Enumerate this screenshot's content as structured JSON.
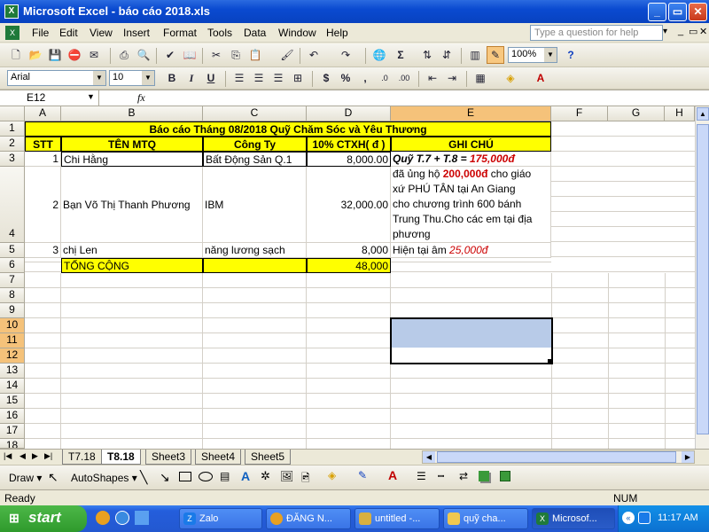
{
  "window": {
    "title": "Microsoft Excel - báo cáo 2018.xls",
    "minimize": "_",
    "restore": "▭",
    "close": "✕"
  },
  "menu": {
    "items": [
      "File",
      "Edit",
      "View",
      "Insert",
      "Format",
      "Tools",
      "Data",
      "Window",
      "Help"
    ],
    "help_placeholder": "Type a question for help"
  },
  "toolbar": {
    "zoom": "100%",
    "font": "Arial",
    "size": "10"
  },
  "formula_bar": {
    "name_box": "E12",
    "fx": "fx",
    "content": ""
  },
  "grid": {
    "columns": [
      "A",
      "B",
      "C",
      "D",
      "E",
      "F",
      "G",
      "H"
    ],
    "rows": [
      "1",
      "2",
      "3",
      "4",
      "5",
      "6",
      "7",
      "8",
      "9",
      "10",
      "11",
      "12",
      "13",
      "14",
      "15",
      "16",
      "17",
      "18"
    ],
    "title": "Báo cáo Tháng 08/2018 Quỹ Chăm Sóc và Yêu Thương",
    "headers": {
      "stt": "STT",
      "ten": "TÊN MTQ",
      "congty": "Công Ty",
      "ctxh": "10% CTXH( đ )",
      "ghichu": "GHI CHÚ"
    },
    "r3": {
      "stt": "1",
      "ten": "Chi Hằng",
      "congty": "Bất Động Sản Q.1",
      "ctxh": "8,000.00",
      "note_prefix": "Quỹ T.7 + T.8 =",
      "note_amount": "175,000đ"
    },
    "r4": {
      "stt": "2",
      "ten": "Bạn Võ Thị Thanh Phương",
      "congty": "IBM",
      "ctxh": "32,000.00",
      "note_l1_pre": "đã ủng hộ",
      "note_l1_amt": "200,000đ",
      "note_l1_post": "cho giáo",
      "note_l2": "xứ PHÚ TÂN tại An Giang",
      "note_l3": "cho chương trình 600 bánh",
      "note_l4": "Trung Thu.Cho các em tại địa",
      "note_l5": "phương"
    },
    "r5": {
      "stt": "3",
      "ten": "chị Len",
      "congty": "năng lương sạch",
      "ctxh": "8,000",
      "note_prefix": "Hiện tại âm",
      "note_amount": "25,000đ"
    },
    "r6": {
      "label": "TỔNG CỘNG",
      "total": "48,000"
    }
  },
  "sheets": [
    "T7.18",
    "T8.18",
    "Sheet3",
    "Sheet4",
    "Sheet5"
  ],
  "drawbar": {
    "draw": "Draw",
    "autoshapes": "AutoShapes"
  },
  "status": {
    "left": "Ready",
    "right": "NUM"
  },
  "taskbar": {
    "start": "start",
    "items": [
      "Zalo",
      "ĐĂNG N...",
      "untitled -...",
      "quỹ cha...",
      "Microsof..."
    ],
    "clock": "11:17 AM"
  }
}
